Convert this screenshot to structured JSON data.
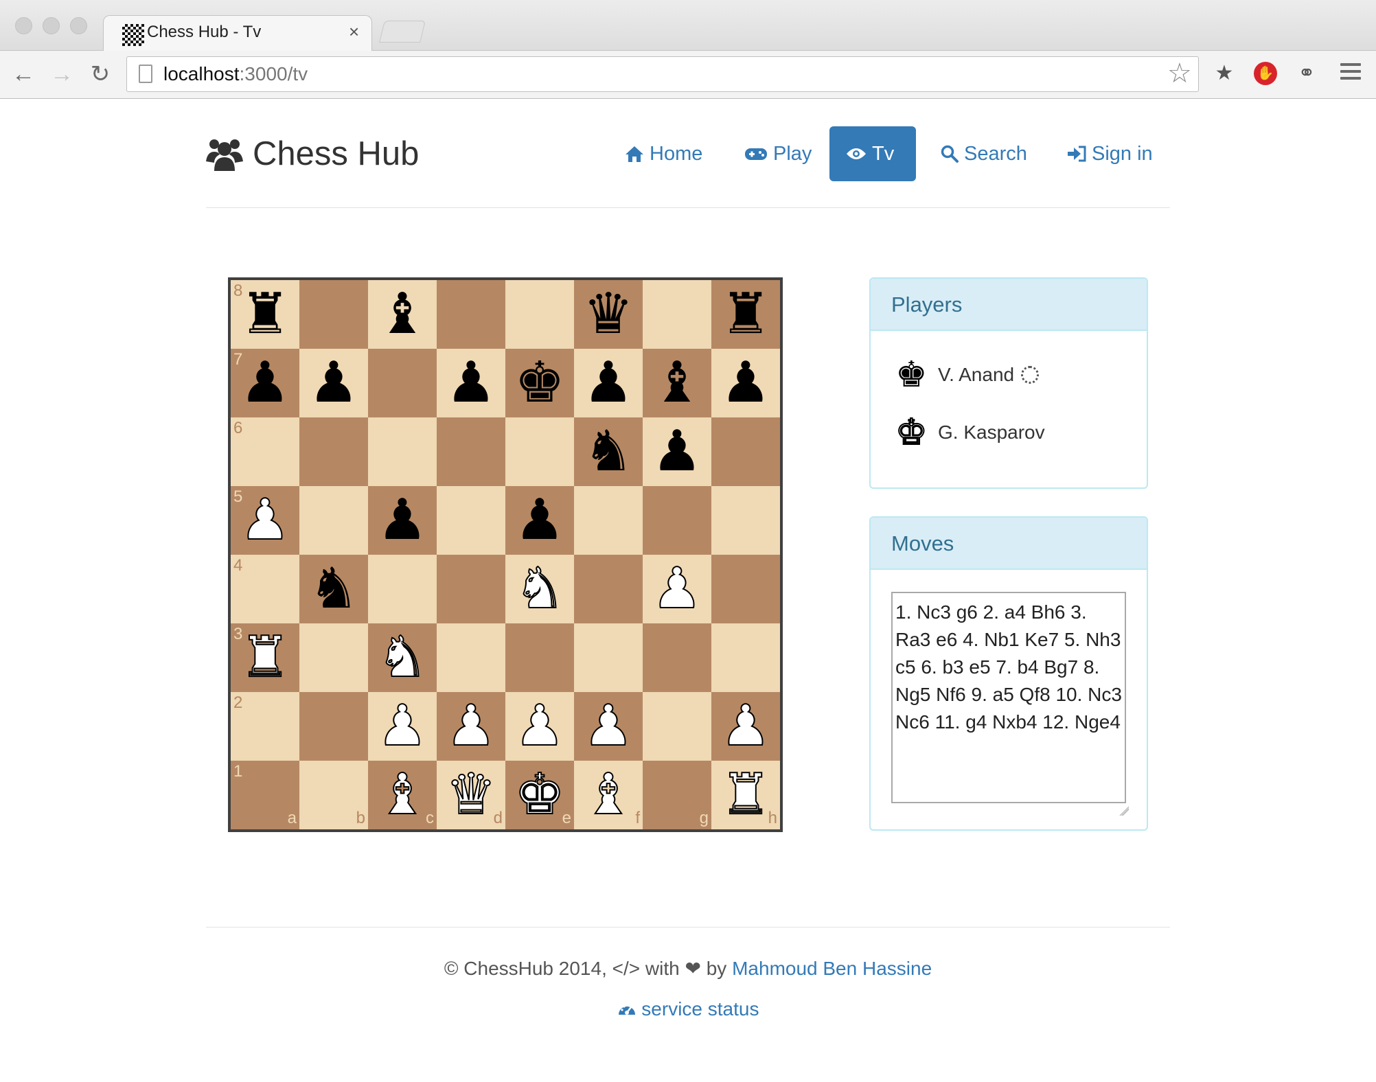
{
  "browser": {
    "tab_title": "Chess Hub - Tv",
    "tab_close": "×",
    "url_host": "localhost",
    "url_path": ":3000/tv"
  },
  "site": {
    "brand": "Chess Hub",
    "nav": [
      {
        "label": "Home",
        "icon": "home-icon",
        "active": false
      },
      {
        "label": "Play",
        "icon": "gamepad-icon",
        "active": false
      },
      {
        "label": "Tv",
        "icon": "eye-icon",
        "active": true
      },
      {
        "label": "Search",
        "icon": "search-icon",
        "active": false
      },
      {
        "label": "Sign in",
        "icon": "sign-in-icon",
        "active": false
      }
    ]
  },
  "board": {
    "files": [
      "a",
      "b",
      "c",
      "d",
      "e",
      "f",
      "g",
      "h"
    ],
    "ranks": [
      "8",
      "7",
      "6",
      "5",
      "4",
      "3",
      "2",
      "1"
    ],
    "position": [
      [
        "br",
        "",
        "bb",
        "",
        "",
        "bq",
        "",
        "br"
      ],
      [
        "bp",
        "bp",
        "",
        "bp",
        "bk",
        "bp",
        "bb",
        "bp"
      ],
      [
        "",
        "",
        "",
        "",
        "",
        "bn",
        "bp",
        ""
      ],
      [
        "wp",
        "",
        "bp",
        "",
        "bp",
        "",
        "",
        ""
      ],
      [
        "",
        "bn",
        "",
        "",
        "wn",
        "",
        "wp",
        ""
      ],
      [
        "wr",
        "",
        "wn",
        "",
        "",
        "",
        "",
        ""
      ],
      [
        "",
        "",
        "wp",
        "wp",
        "wp",
        "wp",
        "",
        "wp"
      ],
      [
        "",
        "",
        "wb",
        "wq",
        "wk",
        "wb",
        "",
        "wr"
      ]
    ]
  },
  "players": {
    "heading": "Players",
    "black": "V. Anand",
    "white": "G. Kasparov"
  },
  "moves": {
    "heading": "Moves",
    "text": "1. Nc3 g6 2. a4 Bh6 3. Ra3 e6 4. Nb1 Ke7 5. Nh3 c5 6. b3 e5 7. b4 Bg7 8. Ng5 Nf6 9. a5 Qf8 10. Nc3 Nc6 11. g4 Nxb4 12. Nge4"
  },
  "footer": {
    "copyright": "© ChessHub 2014,",
    "code_symbol": "</>",
    "with": "with",
    "by": "by",
    "author": "Mahmoud Ben Hassine",
    "status": "service status"
  },
  "colors": {
    "link": "#337ab7",
    "light_square": "#f0d9b5",
    "dark_square": "#b58863",
    "panel_head": "#d9edf7"
  }
}
